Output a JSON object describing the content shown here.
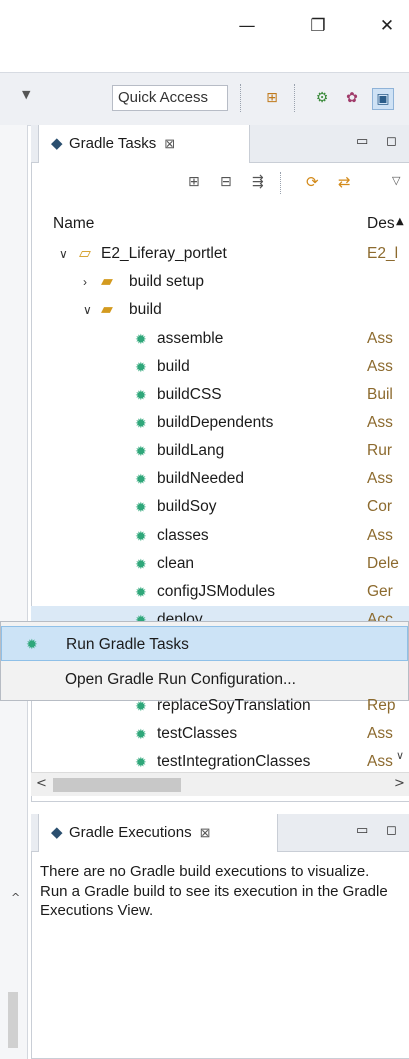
{
  "window": {
    "minimize": "—",
    "restore": "❐",
    "close": "✕"
  },
  "toolbar": {
    "quick_access": "Quick Access"
  },
  "tasks_view": {
    "tab_label": "Gradle Tasks",
    "columns": {
      "name": "Name",
      "desc": "Des"
    },
    "project": {
      "name": "E2_Liferay_portlet",
      "desc": "E2_l"
    },
    "groups": [
      {
        "name": "build setup",
        "expanded": false
      },
      {
        "name": "build",
        "expanded": true
      }
    ],
    "tasks": [
      {
        "name": "assemble",
        "desc": "Ass"
      },
      {
        "name": "build",
        "desc": "Ass"
      },
      {
        "name": "buildCSS",
        "desc": "Buil"
      },
      {
        "name": "buildDependents",
        "desc": "Ass"
      },
      {
        "name": "buildLang",
        "desc": "Rur"
      },
      {
        "name": "buildNeeded",
        "desc": "Ass"
      },
      {
        "name": "buildSoy",
        "desc": "Cor"
      },
      {
        "name": "classes",
        "desc": "Ass"
      },
      {
        "name": "clean",
        "desc": "Dele"
      },
      {
        "name": "configJSModules",
        "desc": "Ger"
      },
      {
        "name": "deploy",
        "desc": "Acc"
      }
    ],
    "tasks_below_menu": [
      {
        "name": "replaceSoyTranslation",
        "desc": "Rep"
      },
      {
        "name": "testClasses",
        "desc": "Ass"
      },
      {
        "name": "testIntegrationClasses",
        "desc": "Ass"
      }
    ]
  },
  "context_menu": {
    "items": [
      {
        "label": "Run Gradle Tasks",
        "selected": true
      },
      {
        "label": "Open Gradle Run Configuration..."
      }
    ]
  },
  "executions_view": {
    "tab_label": "Gradle Executions",
    "message": "There are no Gradle build executions to visualize. Run a Gradle build to see its execution in the Gradle Executions View."
  },
  "colors": {
    "selection": "#cce3f6",
    "gear": "#2fa77a",
    "folder": "#d39a1f"
  }
}
